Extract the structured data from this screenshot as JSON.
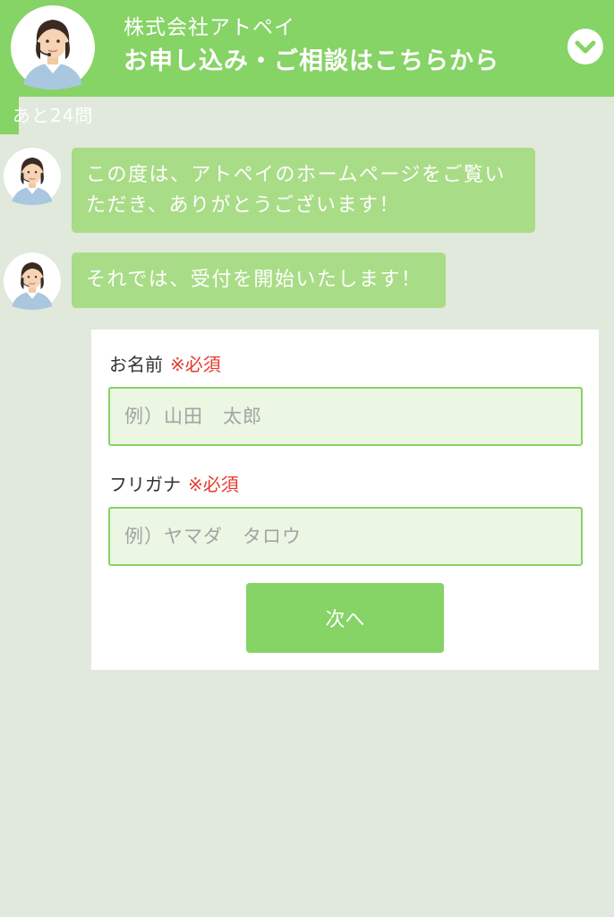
{
  "header": {
    "company": "株式会社アトペイ",
    "headline": "お申し込み・ご相談はこちらから",
    "toggle_icon": "chevron-down-icon"
  },
  "progress": {
    "label": "あと24問",
    "fraction": 0.03
  },
  "messages": [
    {
      "text_lines": [
        "この度は、アトペイのホームページをご覧い",
        "ただき、ありがとうございます！"
      ]
    },
    {
      "text_lines": [
        "それでは、受付を開始いたします！"
      ]
    }
  ],
  "form": {
    "name": {
      "label": "お名前",
      "required": "※必須",
      "placeholder": "例）山田　太郎",
      "value": ""
    },
    "furigana": {
      "label": "フリガナ",
      "required": "※必須",
      "placeholder": "例）ヤマダ　タロウ",
      "value": ""
    },
    "next_label": "次へ"
  },
  "colors": {
    "brand_green": "#86d366",
    "bubble_green": "#a9dc86",
    "background": "#e1e8dc",
    "required_red": "#e53a2c"
  }
}
